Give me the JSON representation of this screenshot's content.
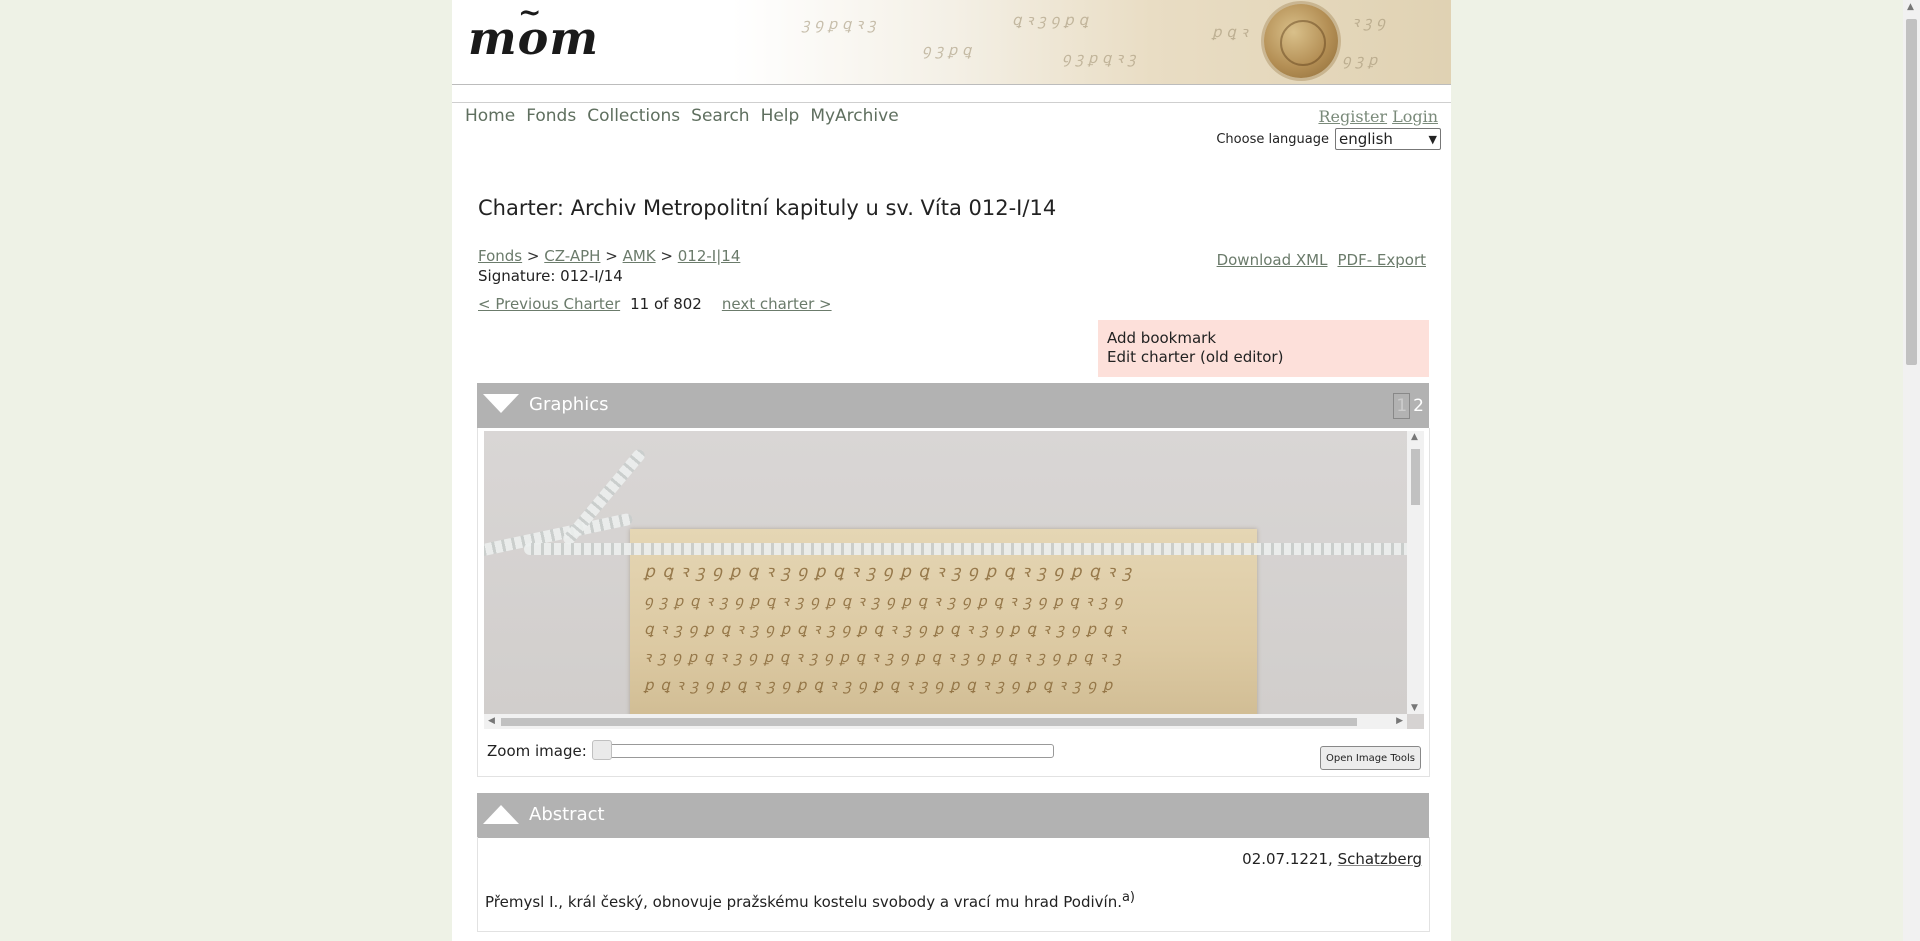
{
  "logo": {
    "text": "mom",
    "tilde": "~"
  },
  "nav": {
    "items": [
      "Home",
      "Fonds",
      "Collections",
      "Search",
      "Help",
      "MyArchive"
    ],
    "register": "Register",
    "login": "Login"
  },
  "language": {
    "label": "Choose language",
    "selected": "english"
  },
  "charter": {
    "title": "Charter: Archiv Metropolitní kapituly u sv. Víta 012-I/14",
    "breadcrumb": [
      "Fonds",
      "CZ-APH",
      "AMK",
      "012-I|14"
    ],
    "breadcrumb_sep": ">",
    "signature": "Signature: 012-I/14",
    "download_xml": "Download XML",
    "pdf_export": "PDF- Export",
    "prev": "< Previous Charter",
    "count": "11 of 802",
    "next": "next charter >",
    "actions": [
      "Add bookmark",
      "Edit charter (old editor)"
    ]
  },
  "graphics": {
    "title": "Graphics",
    "pages": [
      "1",
      "2"
    ],
    "zoom_label": "Zoom image:",
    "zoom_level": 0,
    "tools_button": "Open Image Tools"
  },
  "abstract": {
    "title": "Abstract",
    "date": "02.07.1221",
    "place": "Schatzberg",
    "text": "Přemysl I., král český, obnovuje pražskému kostelu svobody a vrací mu hrad Podivín.",
    "note": "a)"
  },
  "colors": {
    "background": "#eef2e6",
    "section_header": "#b2b2b2",
    "action_box": "#fde0da",
    "link": "#6b7b6b"
  }
}
